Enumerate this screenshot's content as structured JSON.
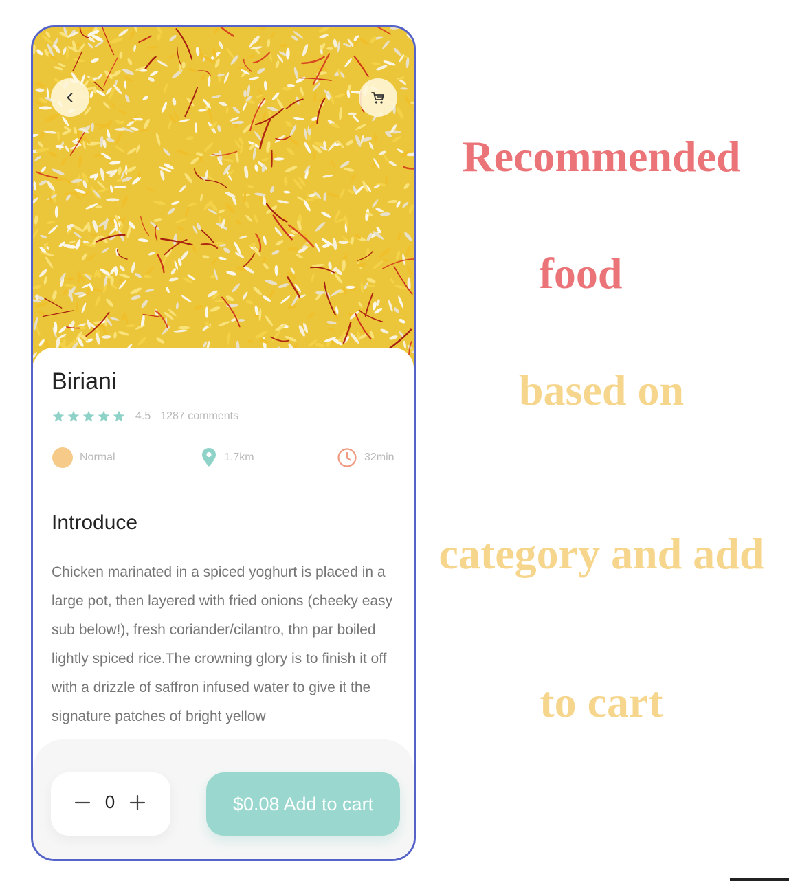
{
  "dish": {
    "name": "Biriani",
    "rating": "4.5",
    "comments": "1287 comments",
    "star_count": 5,
    "spice_level": "Normal",
    "distance": "1.7km",
    "time": "32min",
    "section_title": "Introduce",
    "description": "Chicken marinated in a spiced yoghurt is placed in a large pot, then layered with fried onions (cheeky easy sub below!), fresh coriander/cilantro, thn par boiled lightly spiced rice.The crowning glory is to finish it off with a drizzle of saffron infused water to give it the signature patches of bright yellow"
  },
  "cart": {
    "quantity": "0",
    "add_label": "$0.08 Add to cart"
  },
  "caption": {
    "line1": "Recommended",
    "line2": "food",
    "line3": "based on",
    "line4": "category and add",
    "line5": "to cart"
  },
  "icons": {
    "back": "chevron-left-icon",
    "cart": "cart-icon",
    "star": "star-icon",
    "spice": "spice-level-dot",
    "location": "location-pin-icon",
    "clock": "clock-icon",
    "minus": "minus-icon",
    "plus": "plus-icon"
  },
  "colors": {
    "accent": "#9ad8cf",
    "star": "#8fd3c8",
    "frame": "#5563c8",
    "caption_red": "#ea7478",
    "caption_yellow": "#f6d68c",
    "spice_dot": "#f6cb8a",
    "clock": "#ef9a80"
  }
}
